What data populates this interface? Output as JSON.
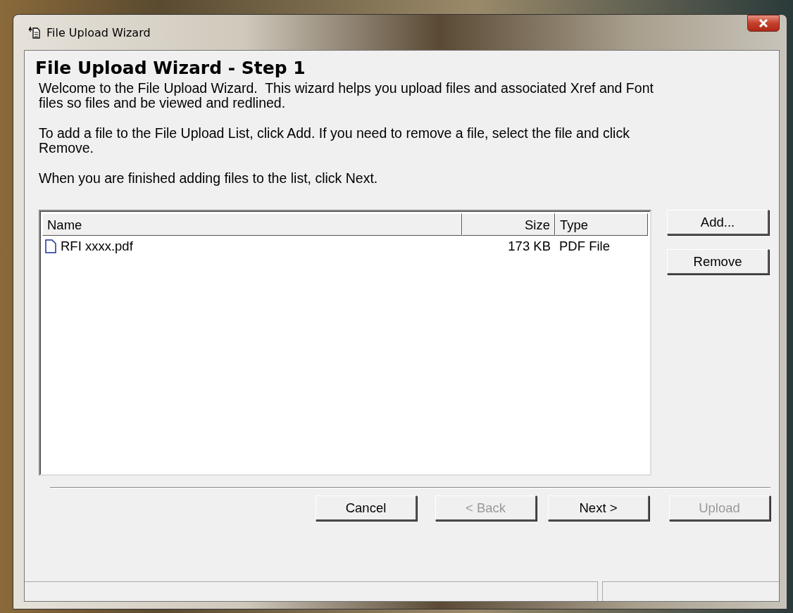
{
  "window": {
    "title": "File Upload Wizard"
  },
  "heading": "File Upload Wizard - Step 1",
  "paragraphs": [
    "Welcome to the File Upload Wizard.  This wizard helps you upload files and associated Xref and Font files so files and be viewed and redlined.",
    "To add a file to the File Upload List, click Add. If you need to remove a file, select the file and click Remove.",
    "When you are finished adding files to the list, click Next."
  ],
  "file_list": {
    "columns": [
      {
        "label": "Name"
      },
      {
        "label": "Size"
      },
      {
        "label": "Type"
      }
    ],
    "rows": [
      {
        "cells": [
          "RFI xxxx.pdf",
          "173 KB",
          "PDF File"
        ],
        "selected": false
      }
    ]
  },
  "side_buttons": [
    {
      "label": "Add...",
      "disabled": false
    },
    {
      "label": "Remove",
      "disabled": false
    }
  ],
  "nav_buttons": [
    {
      "label": "Cancel",
      "disabled": false
    },
    {
      "label": "< Back",
      "disabled": true
    },
    {
      "label": "Next >",
      "disabled": false
    },
    {
      "label": "Upload",
      "disabled": true
    }
  ]
}
